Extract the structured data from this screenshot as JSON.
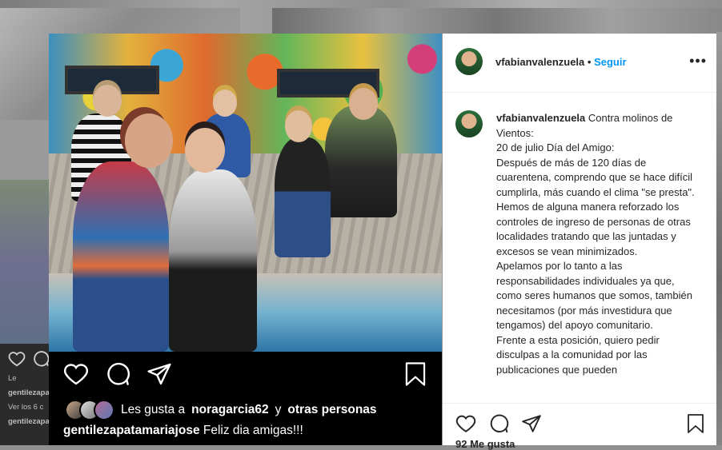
{
  "post": {
    "username": "vfabianvalenzuela",
    "follow_separator": "•",
    "follow_label": "Seguir",
    "more_label": "•••",
    "caption_user": "vfabianvalenzuela",
    "caption_text": "Contra molinos de Vientos:\n20 de julio Día del Amigo:\nDespués de más de 120 días de cuarentena, comprendo que se hace difícil cumplirla, más cuando el clima \"se presta\". Hemos de alguna manera reforzado los controles de ingreso de personas de otras localidades tratando que las juntadas y excesos se vean minimizados.\nApelamos por lo tanto a las responsabilidades individuales ya que, como seres humanos que somos, también necesitamos (por más investidura que tengamos) del apoyo comunitario.\nFrente a esta posición, quiero pedir disculpas a la comunidad por las publicaciones que pueden",
    "likes_label": "92 Me gusta"
  },
  "photo_overlay": {
    "likes_prefix": "Les gusta a",
    "likes_user": "noragarcia62",
    "likes_and": "y",
    "likes_others": "otras personas",
    "caption_user": "gentilezapatamariajose",
    "caption_text": "Feliz dia amigas!!!"
  },
  "background_feed": {
    "mini_likes_user": "gentilezapa",
    "mini_view_comments": "Ver los 6 c",
    "mini_user2": "gentilezapa",
    "mini_prefix": "Le"
  },
  "icons": [
    "heart-icon",
    "comment-icon",
    "share-icon",
    "bookmark-icon",
    "more-icon"
  ],
  "colors": {
    "link_blue": "#0095f6",
    "text": "#262626",
    "border": "#efefef"
  }
}
